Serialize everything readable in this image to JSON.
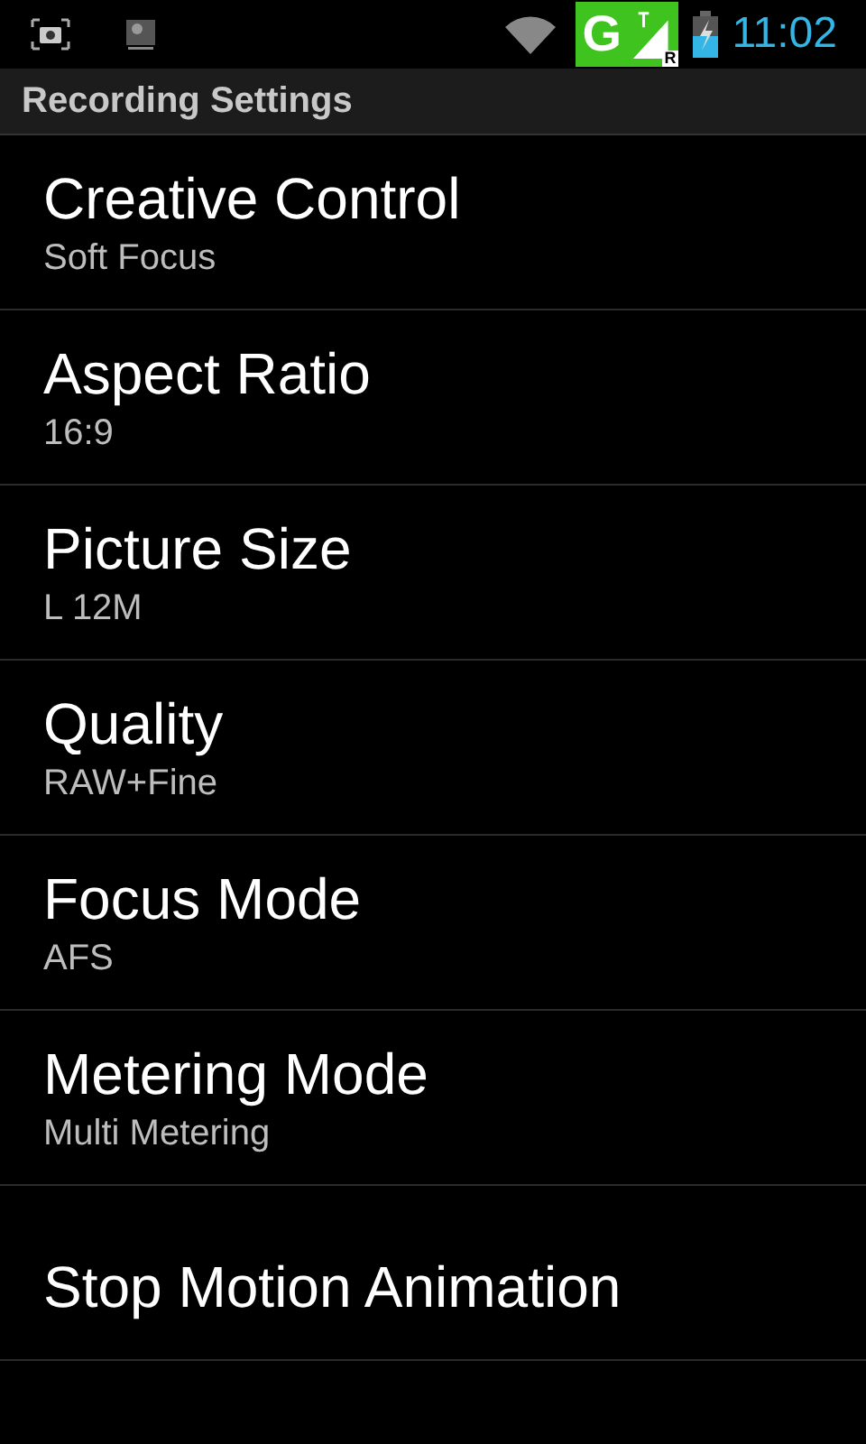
{
  "status_bar": {
    "network": "G",
    "roaming": "R",
    "time": "11:02"
  },
  "header": {
    "title": "Recording Settings"
  },
  "settings": [
    {
      "title": "Creative Control",
      "summary": "Soft Focus"
    },
    {
      "title": "Aspect Ratio",
      "summary": "16:9"
    },
    {
      "title": "Picture Size",
      "summary": "L 12M"
    },
    {
      "title": "Quality",
      "summary": "RAW+Fine"
    },
    {
      "title": "Focus Mode",
      "summary": "AFS"
    },
    {
      "title": "Metering Mode",
      "summary": "Multi Metering"
    },
    {
      "title": "Stop Motion Animation"
    }
  ]
}
